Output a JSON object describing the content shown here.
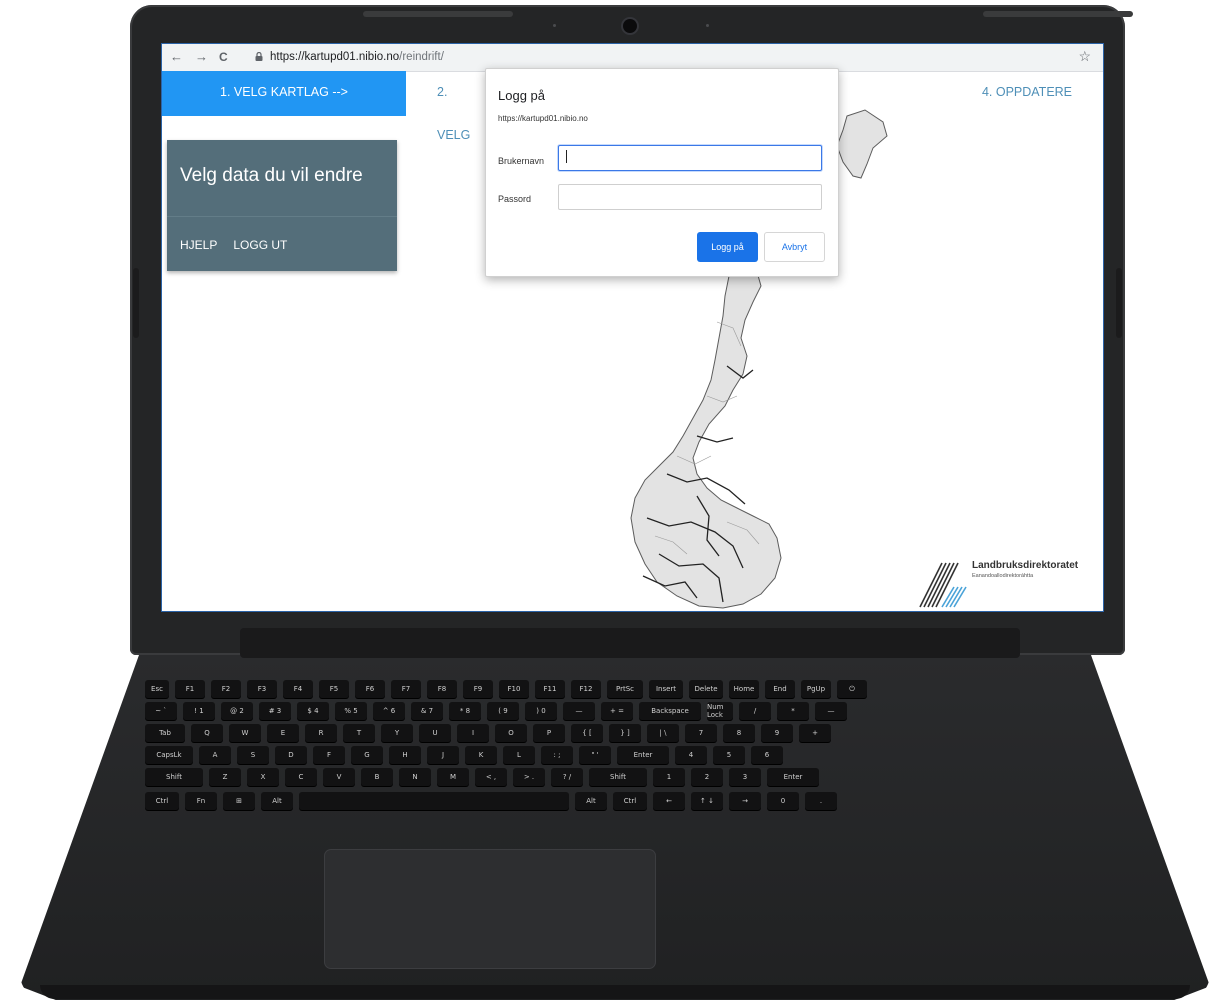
{
  "browser": {
    "url_host": "https://kartupd01.nibio.no",
    "url_path": "/reindrift/",
    "back_icon": "←",
    "forward_icon": "→",
    "reload_icon": "C",
    "star_icon": "☆"
  },
  "steps": [
    {
      "label": "1. VELG KARTLAG -->"
    },
    {
      "label": "2. VELG"
    },
    {
      "label": "->"
    },
    {
      "label": "4. OPPDATERE"
    }
  ],
  "panel": {
    "title": "Velg data du vil endre",
    "help": "HJELP",
    "logout": "LOGG UT"
  },
  "dialog": {
    "title": "Logg på",
    "origin": "https://kartupd01.nibio.no",
    "username_label": "Brukernavn",
    "username_value": "",
    "password_label": "Passord",
    "password_value": "",
    "submit_label": "Logg på",
    "cancel_label": "Avbryt"
  },
  "logo": {
    "name": "Landbruksdirektoratet",
    "subtitle": "Eanandoallodirektoráhtta"
  },
  "keyboard": {
    "row1": [
      "Esc",
      "F1",
      "F2",
      "F3",
      "F4",
      "F5",
      "F6",
      "F7",
      "F8",
      "F9",
      "F10",
      "F11",
      "F12",
      "PrtSc",
      "Insert",
      "Delete",
      "Home",
      "End",
      "PgUp",
      "⏻"
    ],
    "row2": [
      "~ `",
      "! 1",
      "@ 2",
      "# 3",
      "$ 4",
      "% 5",
      "^ 6",
      "& 7",
      "* 8",
      "( 9",
      ") 0",
      "—",
      "+ =",
      "Backspace",
      "Num Lock",
      "/",
      "*",
      "—"
    ],
    "row3": [
      "Tab",
      "Q",
      "W",
      "E",
      "R",
      "T",
      "Y",
      "U",
      "I",
      "O",
      "P",
      "{ [",
      "} ]",
      "| \\",
      "7",
      "8",
      "9",
      "+"
    ],
    "row4": [
      "CapsLk",
      "A",
      "S",
      "D",
      "F",
      "G",
      "H",
      "J",
      "K",
      "L",
      ": ;",
      "\" '",
      "Enter",
      "4",
      "5",
      "6"
    ],
    "row5": [
      "Shift",
      "Z",
      "X",
      "C",
      "V",
      "B",
      "N",
      "M",
      "< ,",
      "> .",
      "? /",
      "Shift",
      "1",
      "2",
      "3",
      "Enter"
    ],
    "row6": [
      "Ctrl",
      "Fn",
      "⊞",
      "Alt",
      "",
      "Alt",
      "Ctrl",
      "←",
      "↑ ↓",
      "→",
      "0",
      "."
    ]
  }
}
